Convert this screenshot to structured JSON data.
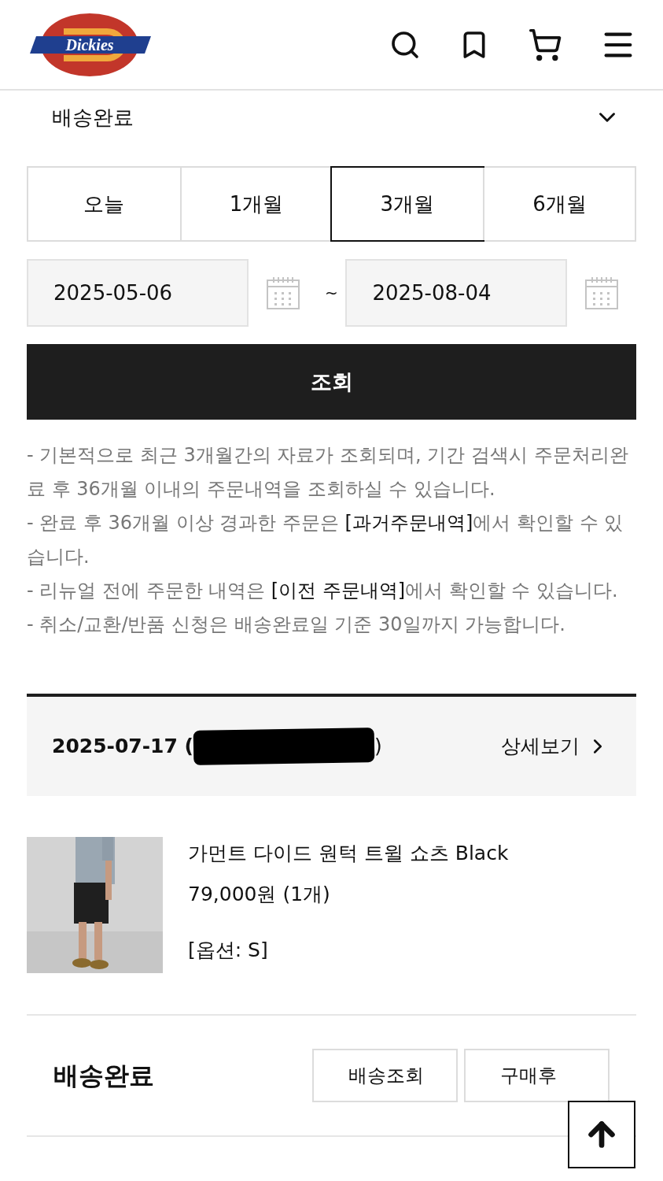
{
  "header": {
    "logo_text": "Dickies"
  },
  "status_filter": {
    "value": "배송완료"
  },
  "period_tabs": [
    {
      "label": "오늘",
      "selected": false
    },
    {
      "label": "1개월",
      "selected": false
    },
    {
      "label": "3개월",
      "selected": true
    },
    {
      "label": "6개월",
      "selected": false
    }
  ],
  "date_range": {
    "start": "2025-05-06",
    "separator": "~",
    "end": "2025-08-04"
  },
  "search_button": "조회",
  "notices": [
    {
      "text": "- 기본적으로 최근 3개월간의 자료가 조회되며, 기간 검색시 주문처리완료 후 36개월 이내의 주문내역을 조회하실 수 있습니다."
    },
    {
      "text": "- 완료 후 36개월 이상 경과한 주문은 ",
      "link": "[과거주문내역]",
      "after": "에서 확인할 수 있습니다."
    },
    {
      "text": "- 리뉴얼 전에 주문한 내역은 ",
      "link": "[이전 주문내역]",
      "after": "에서 확인할 수 있습니다."
    },
    {
      "text": "- 취소/교환/반품 신청은 배송완료일 기준 30일까지 가능합니다."
    }
  ],
  "order": {
    "date": "2025-07-17 (",
    "close": ")",
    "detail_link": "상세보기",
    "product": {
      "kind": "picture",
      "name": "가먼트 다이드 원턱 트윌 쇼츠 Black",
      "price": "79,000원 (1개)",
      "option": "[옵션: S]"
    },
    "status": "배송완료",
    "actions": [
      "배송조회",
      "구매후"
    ]
  }
}
